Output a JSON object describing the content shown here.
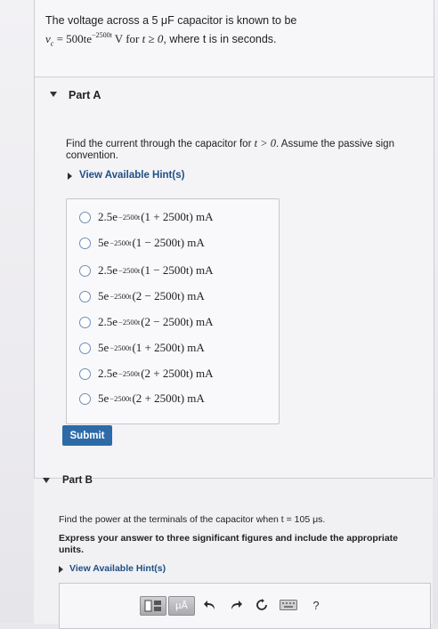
{
  "problem": {
    "line1": "The voltage across a 5 μF capacitor is known to be",
    "v_sym": "v",
    "v_sub": "c",
    "eq_prefix": " = 500te",
    "eq_exp": "−2500t",
    "eq_unit": " V",
    "for_word": " for ",
    "t_cond": "t ≥ 0",
    "tail": ", where t is in seconds."
  },
  "part_a": {
    "title": "Part A",
    "question_pre": "Find the current through the capacitor for ",
    "question_cond": "t > 0",
    "question_post": ". Assume the passive sign convention.",
    "hint": "View Available Hint(s)",
    "choices": [
      {
        "coef": "2.5e",
        "exp": "−2500t",
        "rest": "(1 + 2500t) mA"
      },
      {
        "coef": "5e",
        "exp": "−2500t",
        "rest": "(1 − 2500t) mA"
      },
      {
        "coef": "2.5e",
        "exp": "−2500t",
        "rest": "(1 − 2500t) mA"
      },
      {
        "coef": "5e",
        "exp": "−2500t",
        "rest": "(2 − 2500t) mA"
      },
      {
        "coef": "2.5e",
        "exp": "−2500t",
        "rest": "(2 − 2500t) mA"
      },
      {
        "coef": "5e",
        "exp": "−2500t",
        "rest": "(1 + 2500t) mA"
      },
      {
        "coef": "2.5e",
        "exp": "−2500t",
        "rest": "(2 + 2500t) mA"
      },
      {
        "coef": "5e",
        "exp": "−2500t",
        "rest": "(2 + 2500t) mA"
      }
    ],
    "submit": "Submit"
  },
  "part_b": {
    "title": "Part B",
    "question": "Find the power at the terminals of the capacitor when t = 105 μs.",
    "instruction": "Express your answer to three significant figures and include the appropriate units.",
    "hint": "View Available Hint(s)",
    "toolbar": {
      "units_label": "μÅ",
      "help_label": "?",
      "icons": [
        "templates-icon",
        "units-icon",
        "undo-icon",
        "redo-icon",
        "reset-icon",
        "keyboard-icon",
        "help-icon"
      ]
    }
  },
  "colors": {
    "link": "#1e4f86",
    "submit_bg": "#2d6aa8",
    "radio_border": "#6f8fb6"
  }
}
